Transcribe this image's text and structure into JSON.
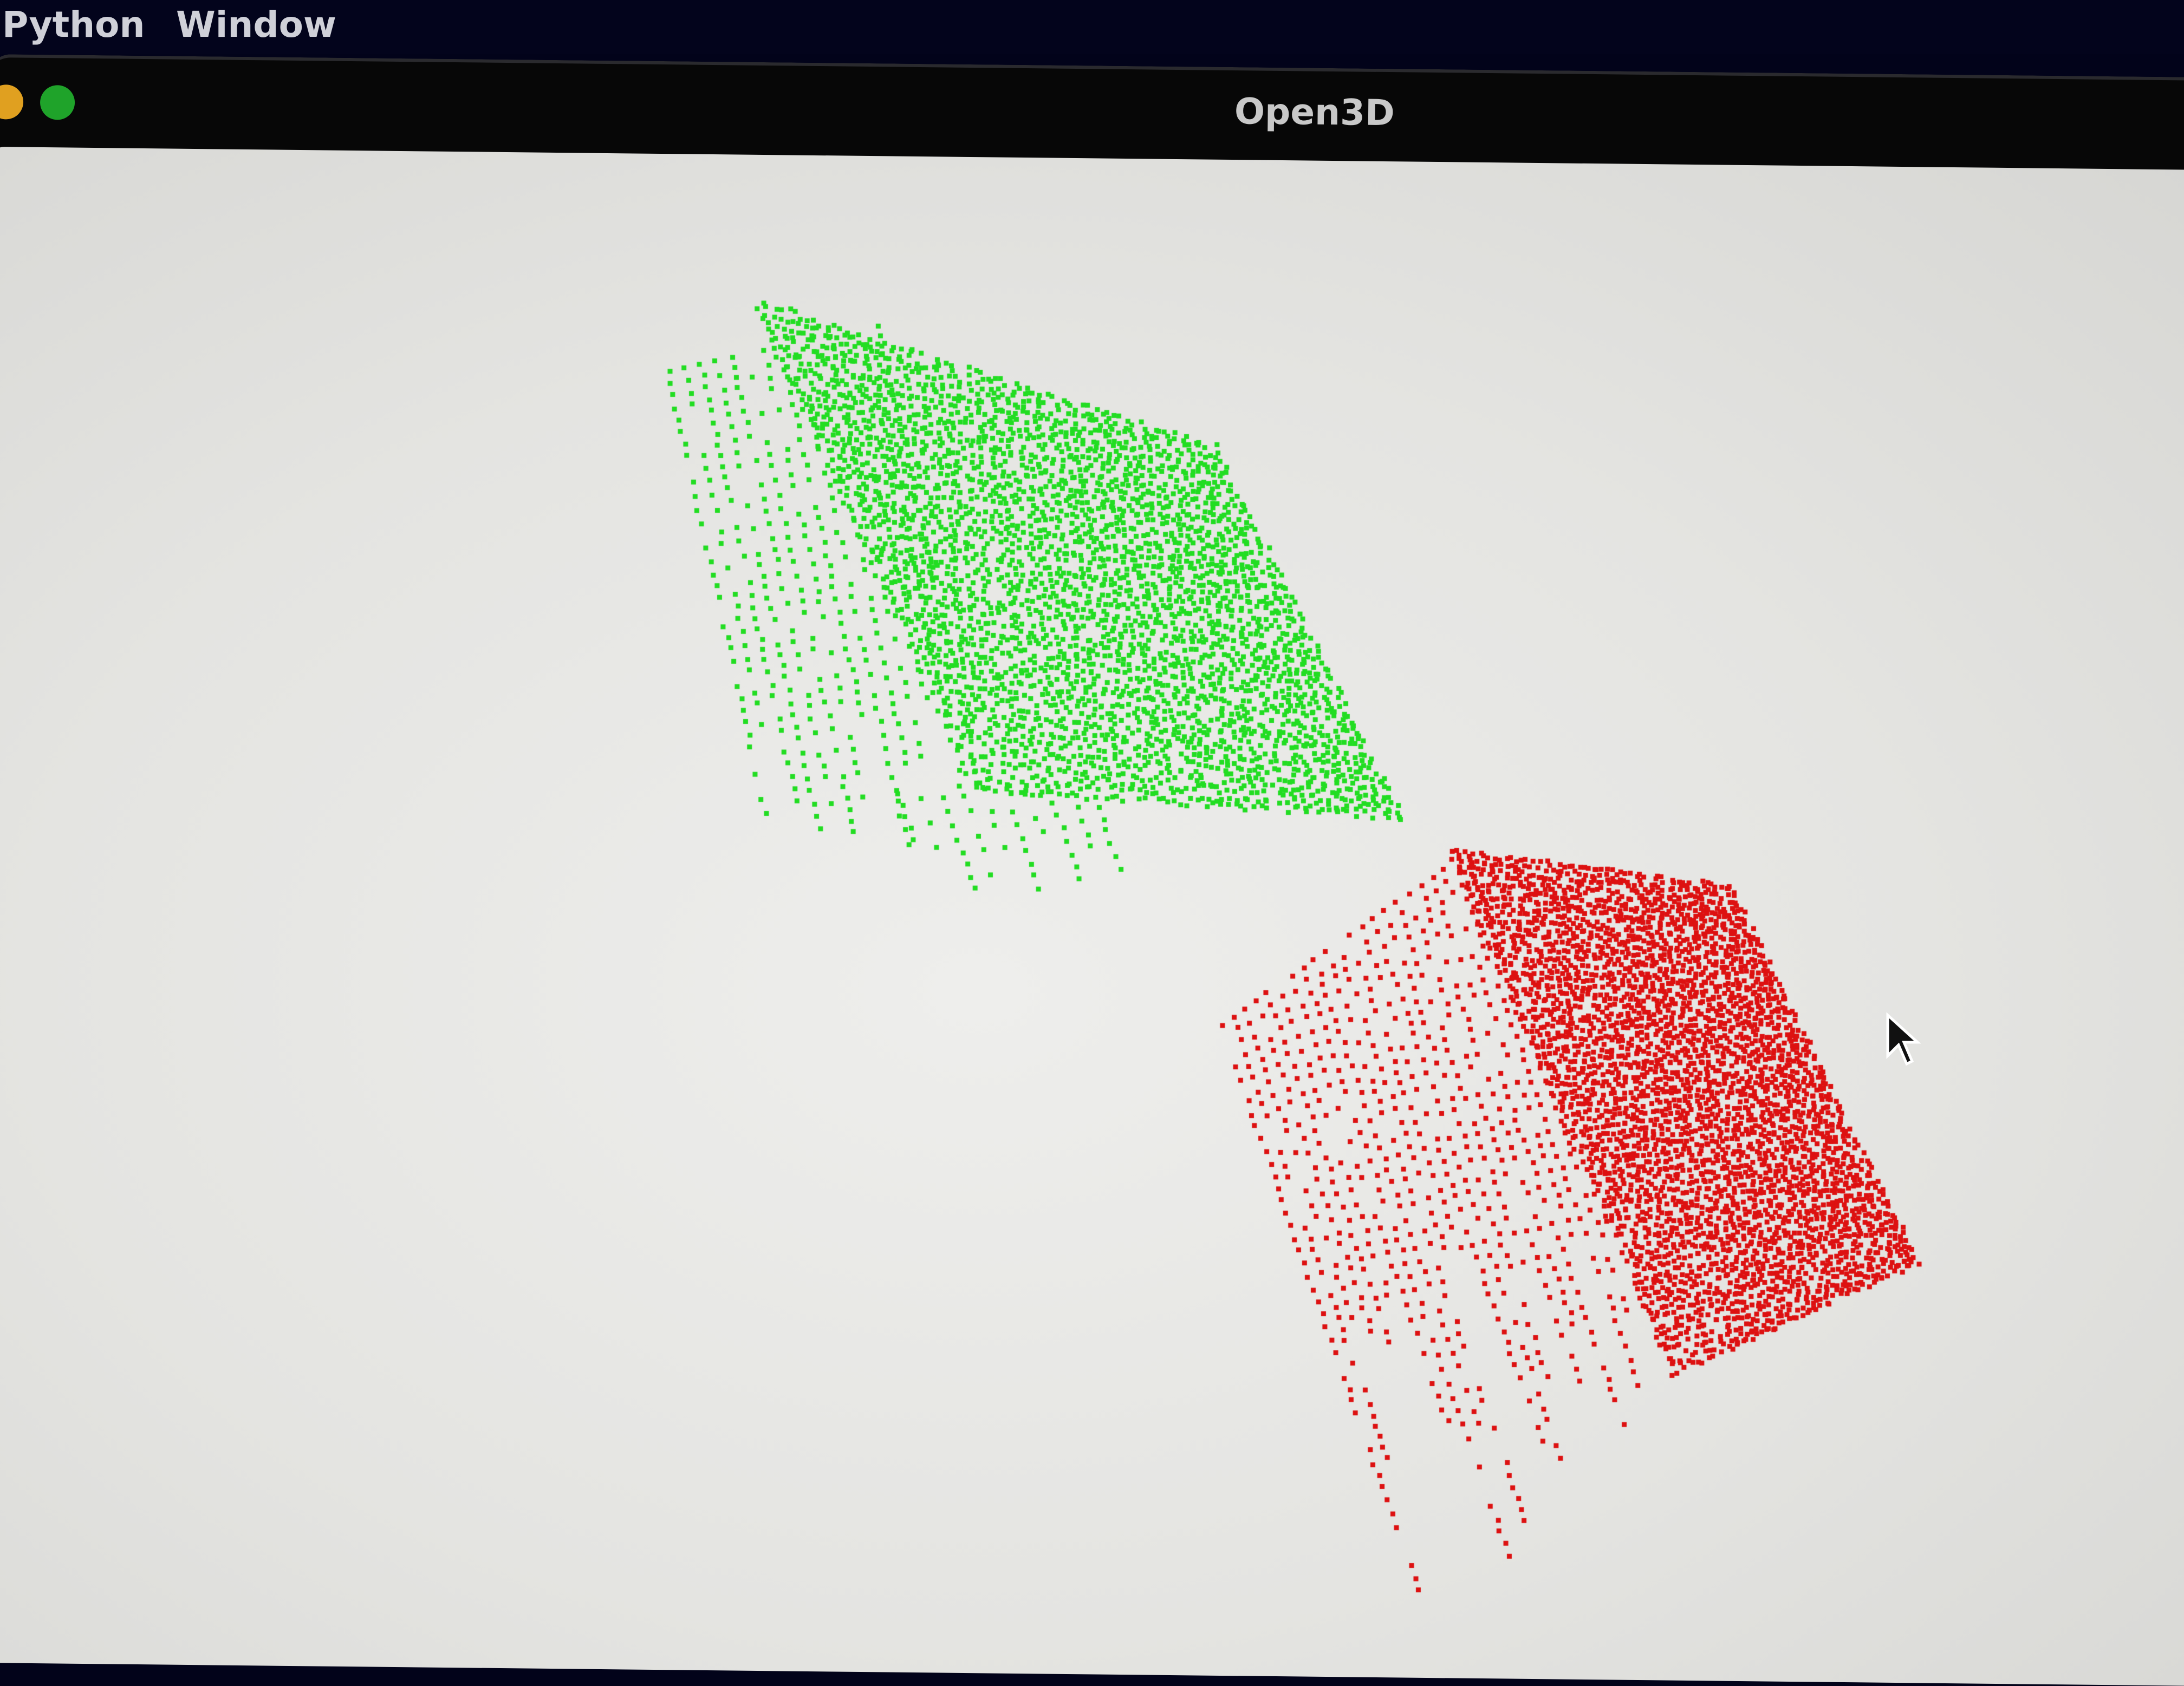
{
  "menubar": {
    "items": [
      {
        "label": "Python"
      },
      {
        "label": "Window"
      }
    ]
  },
  "window": {
    "title": "Open3D",
    "traffic_lights": [
      {
        "name": "minimize",
        "color": "#e0a020"
      },
      {
        "name": "zoom",
        "color": "#1fa32a"
      }
    ]
  },
  "viewport": {
    "background": "#e8e8e6",
    "clouds": [
      {
        "name": "green",
        "color": "#22dd22"
      },
      {
        "name": "red",
        "color": "#dd1111"
      }
    ]
  }
}
